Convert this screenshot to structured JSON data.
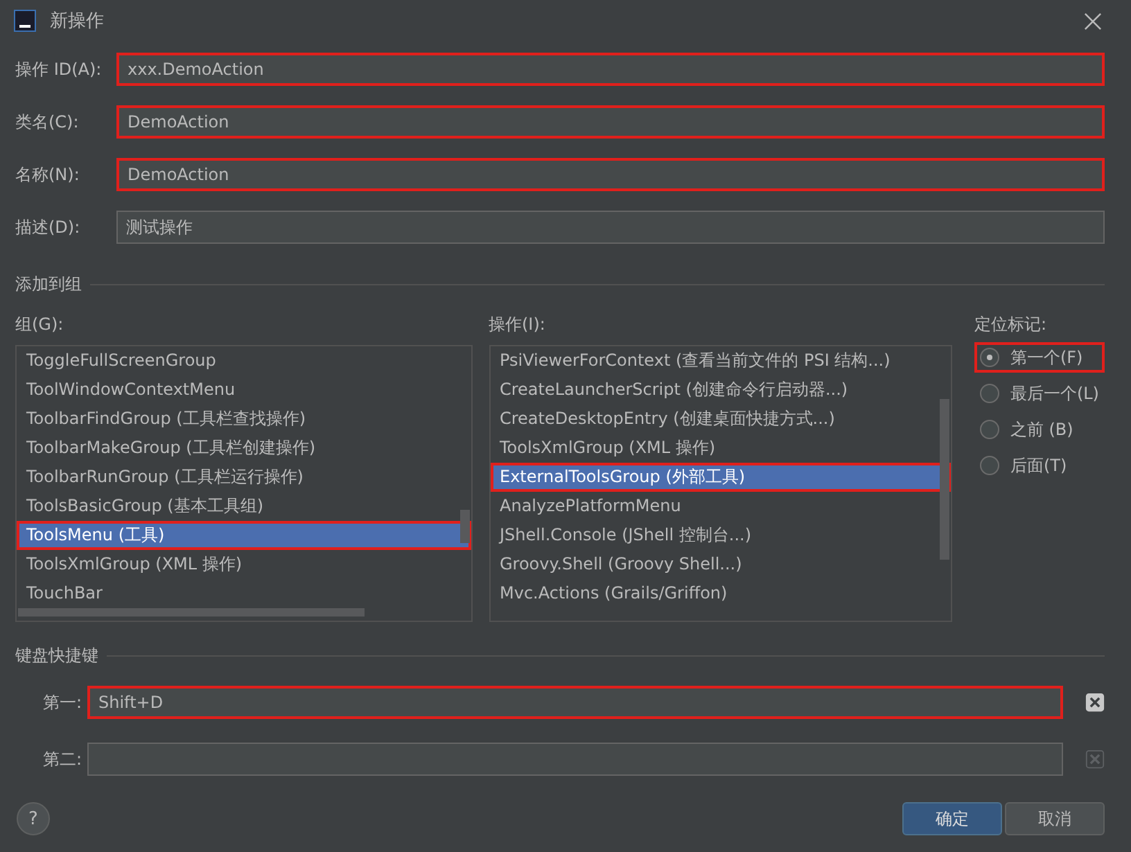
{
  "window": {
    "title": "新操作"
  },
  "fields": [
    {
      "label": "操作 ID(A):",
      "value": "xxx.DemoAction",
      "highlighted": true
    },
    {
      "label": "类名(C):",
      "value": "DemoAction",
      "highlighted": true
    },
    {
      "label": "名称(N):",
      "value": "DemoAction",
      "highlighted": true
    },
    {
      "label": "描述(D):",
      "value": "测试操作",
      "highlighted": false
    }
  ],
  "add_to_group": {
    "title": "添加到组",
    "groups": {
      "label": "组(G):",
      "items": [
        {
          "text": "ToggleFullScreenGroup",
          "selected": false,
          "highlighted": false
        },
        {
          "text": "ToolWindowContextMenu",
          "selected": false,
          "highlighted": false
        },
        {
          "text": "ToolbarFindGroup (工具栏查找操作)",
          "selected": false,
          "highlighted": false
        },
        {
          "text": "ToolbarMakeGroup (工具栏创建操作)",
          "selected": false,
          "highlighted": false
        },
        {
          "text": "ToolbarRunGroup (工具栏运行操作)",
          "selected": false,
          "highlighted": false
        },
        {
          "text": "ToolsBasicGroup (基本工具组)",
          "selected": false,
          "highlighted": false
        },
        {
          "text": "ToolsMenu (工具)",
          "selected": true,
          "highlighted": true
        },
        {
          "text": "ToolsXmlGroup (XML 操作)",
          "selected": false,
          "highlighted": false
        },
        {
          "text": "TouchBar",
          "selected": false,
          "highlighted": false
        }
      ]
    },
    "actions": {
      "label": "操作(I):",
      "items": [
        {
          "text": "PsiViewerForContext (查看当前文件的 PSI 结构...)",
          "selected": false,
          "highlighted": false
        },
        {
          "text": "CreateLauncherScript (创建命令行启动器...)",
          "selected": false,
          "highlighted": false
        },
        {
          "text": "CreateDesktopEntry (创建桌面快捷方式...)",
          "selected": false,
          "highlighted": false
        },
        {
          "text": "ToolsXmlGroup (XML 操作)",
          "selected": false,
          "highlighted": false
        },
        {
          "text": "ExternalToolsGroup (外部工具)",
          "selected": true,
          "highlighted": true
        },
        {
          "text": "AnalyzePlatformMenu",
          "selected": false,
          "highlighted": false
        },
        {
          "text": "JShell.Console (JShell 控制台...)",
          "selected": false,
          "highlighted": false
        },
        {
          "text": "Groovy.Shell (Groovy Shell...)",
          "selected": false,
          "highlighted": false
        },
        {
          "text": "Mvc.Actions (Grails/Griffon)",
          "selected": false,
          "highlighted": false
        }
      ]
    },
    "anchor": {
      "label": "定位标记:",
      "options": [
        {
          "label": "第一个(F)",
          "selected": true,
          "highlighted": true
        },
        {
          "label": "最后一个(L)",
          "selected": false,
          "highlighted": false
        },
        {
          "label": "之前 (B)",
          "selected": false,
          "highlighted": false
        },
        {
          "label": "后面(T)",
          "selected": false,
          "highlighted": false
        }
      ]
    }
  },
  "keyboard_shortcuts": {
    "title": "键盘快捷键",
    "items": [
      {
        "label": "第一:",
        "value": "Shift+D",
        "disabled": false,
        "highlighted": true
      },
      {
        "label": "第二:",
        "value": "",
        "disabled": true,
        "highlighted": false
      }
    ]
  },
  "help_button": "?",
  "buttons": [
    {
      "label": "确定",
      "kind": "primary"
    },
    {
      "label": "取消",
      "kind": "secondary"
    }
  ]
}
